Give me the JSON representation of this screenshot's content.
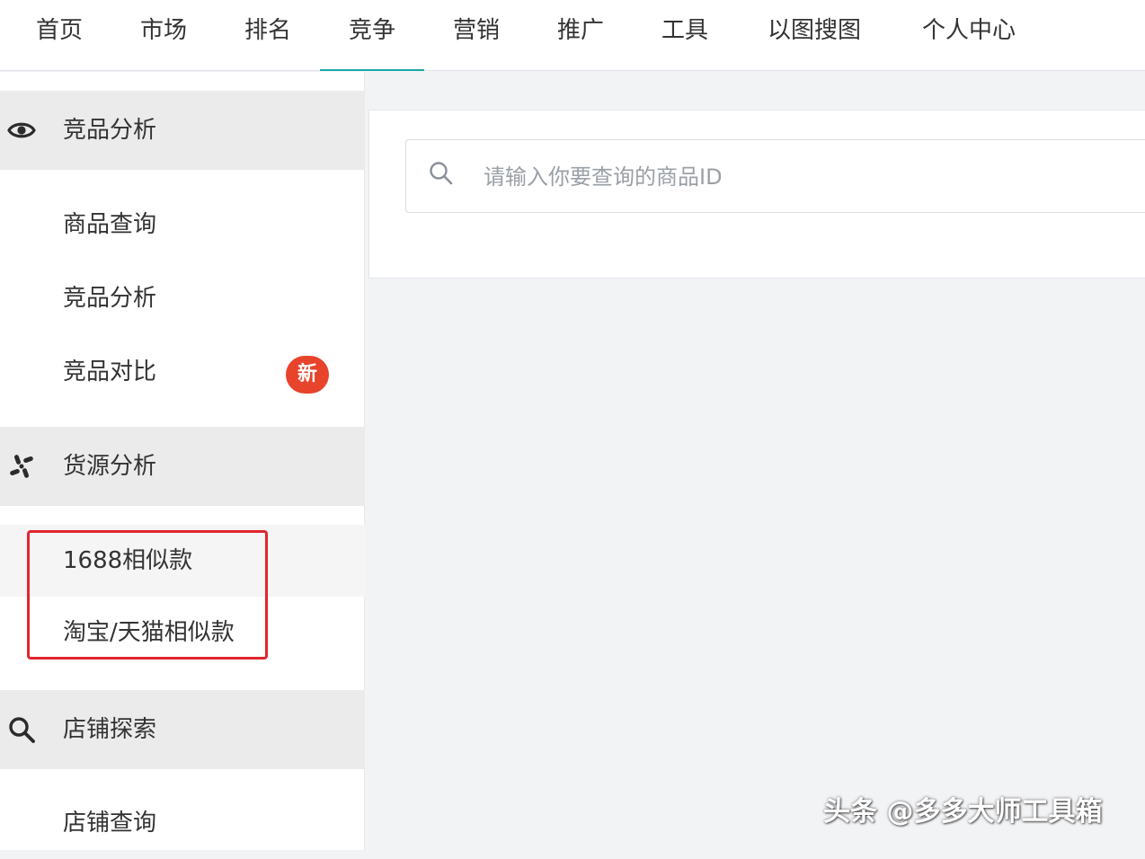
{
  "topnav": {
    "items": [
      {
        "label": "首页"
      },
      {
        "label": "市场"
      },
      {
        "label": "排名"
      },
      {
        "label": "竞争"
      },
      {
        "label": "营销"
      },
      {
        "label": "推广"
      },
      {
        "label": "工具"
      },
      {
        "label": "以图搜图"
      },
      {
        "label": "个人中心"
      }
    ],
    "active": "竞争",
    "accent_color": "#1aa8a8"
  },
  "sidebar": {
    "groups": [
      {
        "label": "竞品分析",
        "icon": "eye-icon"
      },
      {
        "label": "货源分析",
        "icon": "pinwheel-icon"
      },
      {
        "label": "店铺探索",
        "icon": "search-icon"
      }
    ],
    "items": [
      {
        "label": "商品查询"
      },
      {
        "label": "竞品分析"
      },
      {
        "label": "竞品对比",
        "badge": "新"
      },
      {
        "label": "1688相似款"
      },
      {
        "label": "淘宝/天猫相似款"
      },
      {
        "label": "店铺查询"
      }
    ],
    "badge_color": "#e8432b",
    "highlight_box_color": "#e0262e"
  },
  "search": {
    "placeholder": "请输入你要查询的商品ID",
    "value": ""
  },
  "watermark": {
    "text": "头条 @多多大师工具箱"
  }
}
